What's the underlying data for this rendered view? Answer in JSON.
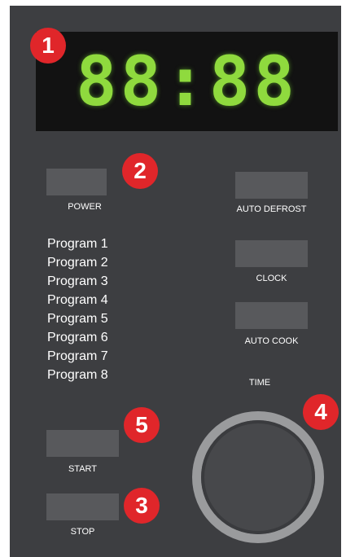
{
  "display": {
    "time": "88:88",
    "color": "#8fda3e"
  },
  "buttons": {
    "power_label": "POWER",
    "auto_defrost_label": "AUTO DEFROST",
    "clock_label": "CLOCK",
    "auto_cook_label": "AUTO COOK",
    "start_label": "START",
    "stop_label": "STOP"
  },
  "programs": [
    "Program 1",
    "Program 2",
    "Program 3",
    "Program 4",
    "Program 5",
    "Program 6",
    "Program 7",
    "Program 8"
  ],
  "dial": {
    "label": "TIME"
  },
  "callouts": {
    "display": "1",
    "power": "2",
    "stop": "3",
    "time_dial": "4",
    "start": "5",
    "color": "#e0262a"
  }
}
